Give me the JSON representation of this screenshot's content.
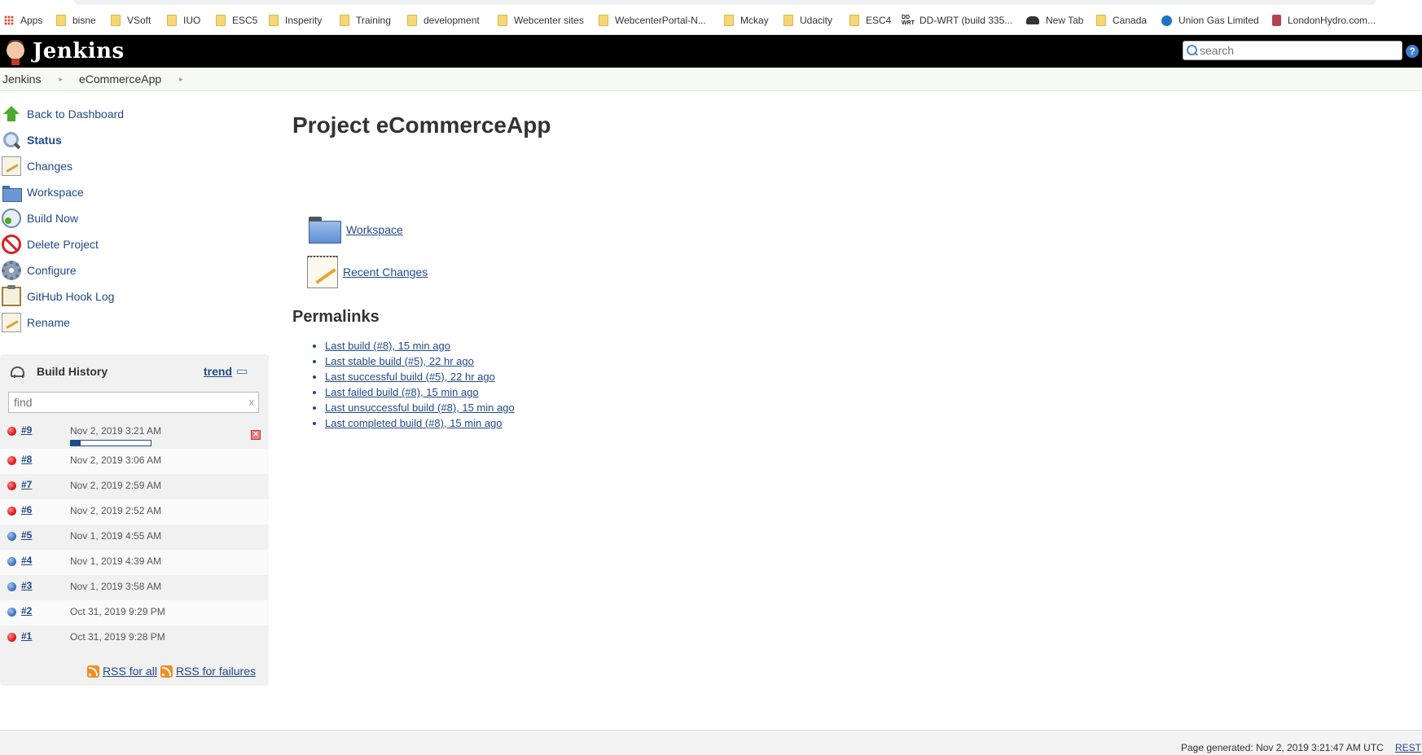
{
  "bookmarks": [
    {
      "label": "Apps",
      "icon": "apps-icon"
    },
    {
      "label": "bisne",
      "icon": "folder-icon"
    },
    {
      "label": "VSoft",
      "icon": "folder-icon"
    },
    {
      "label": "IUO",
      "icon": "folder-icon"
    },
    {
      "label": "ESC5",
      "icon": "folder-icon"
    },
    {
      "label": "Insperity",
      "icon": "folder-icon"
    },
    {
      "label": "Training",
      "icon": "folder-icon"
    },
    {
      "label": "development",
      "icon": "folder-icon"
    },
    {
      "label": "Webcenter sites",
      "icon": "folder-icon"
    },
    {
      "label": "WebcenterPortal-N...",
      "icon": "folder-icon"
    },
    {
      "label": "Mckay",
      "icon": "folder-icon"
    },
    {
      "label": "Udacity",
      "icon": "folder-icon"
    },
    {
      "label": "ESC4",
      "icon": "folder-icon"
    },
    {
      "label": "DD-WRT (build 335...",
      "icon": "ddwrt-icon"
    },
    {
      "label": "New Tab",
      "icon": "incognito-icon"
    },
    {
      "label": "Canada",
      "icon": "folder-icon"
    },
    {
      "label": "Union Gas Limited",
      "icon": "union-gas-icon"
    },
    {
      "label": "LondonHydro.com...",
      "icon": "london-hydro-icon"
    }
  ],
  "header": {
    "logo_text": "Jenkins",
    "search_placeholder": "search",
    "help_label": "?"
  },
  "breadcrumbs": [
    "Jenkins",
    "eCommerceApp"
  ],
  "tasks": [
    {
      "label": "Back to Dashboard",
      "icon": "up-arrow-icon"
    },
    {
      "label": "Status",
      "icon": "search-icon",
      "current": true
    },
    {
      "label": "Changes",
      "icon": "notepad-icon"
    },
    {
      "label": "Workspace",
      "icon": "folder-icon"
    },
    {
      "label": "Build Now",
      "icon": "clock-icon"
    },
    {
      "label": "Delete Project",
      "icon": "no-entry-icon"
    },
    {
      "label": "Configure",
      "icon": "gear-icon"
    },
    {
      "label": "GitHub Hook Log",
      "icon": "clipboard-icon"
    },
    {
      "label": "Rename",
      "icon": "notepad-icon"
    }
  ],
  "build_history": {
    "title": "Build History",
    "trend_label": "trend",
    "filter_placeholder": "find",
    "clear_label": "x",
    "builds": [
      {
        "number": "#9",
        "date": "Nov 2, 2019 3:21 AM",
        "status": "red",
        "in_progress": true,
        "progress": 0.12
      },
      {
        "number": "#8",
        "date": "Nov 2, 2019 3:06 AM",
        "status": "red"
      },
      {
        "number": "#7",
        "date": "Nov 2, 2019 2:59 AM",
        "status": "red"
      },
      {
        "number": "#6",
        "date": "Nov 2, 2019 2:52 AM",
        "status": "red"
      },
      {
        "number": "#5",
        "date": "Nov 1, 2019 4:55 AM",
        "status": "blue"
      },
      {
        "number": "#4",
        "date": "Nov 1, 2019 4:39 AM",
        "status": "blue"
      },
      {
        "number": "#3",
        "date": "Nov 1, 2019 3:58 AM",
        "status": "blue"
      },
      {
        "number": "#2",
        "date": "Oct 31, 2019 9:29 PM",
        "status": "blue"
      },
      {
        "number": "#1",
        "date": "Oct 31, 2019 9:28 PM",
        "status": "red"
      }
    ],
    "rss_all": "RSS for all",
    "rss_failures": "RSS for failures"
  },
  "main": {
    "title": "Project eCommerceApp",
    "workspace_link": "Workspace",
    "recent_changes_link": "Recent Changes",
    "permalinks_title": "Permalinks",
    "permalinks": [
      "Last build (#8), 15 min ago",
      "Last stable build (#5), 22 hr ago",
      "Last successful build (#5), 22 hr ago",
      "Last failed build (#8), 15 min ago",
      "Last unsuccessful build (#8), 15 min ago",
      "Last completed build (#8), 15 min ago"
    ]
  },
  "footer": {
    "generated": "Page generated: Nov 2, 2019 3:21:47 AM UTC",
    "rest_link": "REST"
  },
  "colors": {
    "link": "#204a87",
    "header_bg": "#000000",
    "failed": "#e02424",
    "success": "#4a7bc8"
  }
}
